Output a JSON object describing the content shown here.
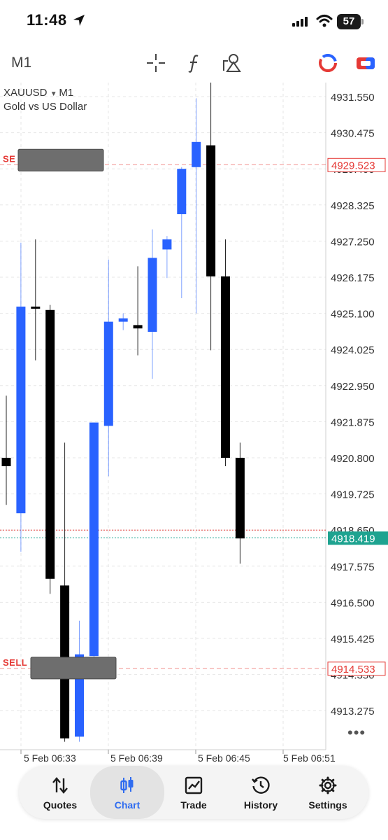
{
  "status": {
    "time": "11:48",
    "battery": "57"
  },
  "toolbar": {
    "timeframe": "M1"
  },
  "chart_data": {
    "type": "candlestick",
    "symbol": "XAUUSD",
    "period": "M1",
    "description": "Gold vs US Dollar",
    "y_ticks": [
      "4931.550",
      "4930.475",
      "4929.400",
      "4928.325",
      "4927.250",
      "4926.175",
      "4925.100",
      "4924.025",
      "4922.950",
      "4921.875",
      "4920.800",
      "4919.725",
      "4918.650",
      "4917.575",
      "4916.500",
      "4915.425",
      "4914.350",
      "4913.275"
    ],
    "y_range": [
      4912.35,
      4932.4
    ],
    "x_labels": [
      "5 Feb 06:33",
      "5 Feb 06:39",
      "5 Feb 06:45",
      "5 Feb 06:51"
    ],
    "candles": [
      {
        "o": 4920.8,
        "h": 4922.65,
        "l": 4919.4,
        "c": 4920.55
      },
      {
        "o": 4919.15,
        "h": 4927.2,
        "l": 4918.0,
        "c": 4925.3
      },
      {
        "o": 4925.3,
        "h": 4927.3,
        "l": 4923.7,
        "c": 4925.25
      },
      {
        "o": 4925.2,
        "h": 4925.35,
        "l": 4916.75,
        "c": 4917.2
      },
      {
        "o": 4917.0,
        "h": 4921.25,
        "l": 4912.35,
        "c": 4912.45
      },
      {
        "o": 4912.5,
        "h": 4915.95,
        "l": 4912.35,
        "c": 4914.95
      },
      {
        "o": 4914.9,
        "h": 4921.85,
        "l": 4914.6,
        "c": 4921.85
      },
      {
        "o": 4921.75,
        "h": 4926.7,
        "l": 4920.25,
        "c": 4924.85
      },
      {
        "o": 4924.85,
        "h": 4925.1,
        "l": 4924.6,
        "c": 4924.95
      },
      {
        "o": 4924.75,
        "h": 4926.5,
        "l": 4923.85,
        "c": 4924.65
      },
      {
        "o": 4924.55,
        "h": 4927.6,
        "l": 4923.15,
        "c": 4926.75
      },
      {
        "o": 4927.0,
        "h": 4927.4,
        "l": 4926.15,
        "c": 4927.3
      },
      {
        "o": 4928.05,
        "h": 4929.45,
        "l": 4925.55,
        "c": 4929.4
      },
      {
        "o": 4929.45,
        "h": 4931.5,
        "l": 4925.1,
        "c": 4930.2
      },
      {
        "o": 4930.1,
        "h": 4932.4,
        "l": 4924.0,
        "c": 4926.2
      },
      {
        "o": 4926.2,
        "h": 4927.3,
        "l": 4920.55,
        "c": 4920.8
      },
      {
        "o": 4920.8,
        "h": 4921.25,
        "l": 4917.65,
        "c": 4918.4
      }
    ],
    "price_lines": [
      {
        "price": 4929.523,
        "label": "4929.523",
        "color": "#e53935",
        "style": "dashed-light"
      },
      {
        "price": 4914.533,
        "label": "4914.533",
        "color": "#e53935",
        "style": "dashed-light"
      },
      {
        "price": 4918.65,
        "label": "",
        "color": "#e53935",
        "style": "dotted"
      },
      {
        "price": 4918.419,
        "label": "4918.419",
        "color": "#1ea390",
        "style": "dotted"
      }
    ],
    "orders": [
      {
        "label": "SELL",
        "price": 4929.523,
        "truncated_label": "SE"
      },
      {
        "label": "SELL",
        "price": 4914.533,
        "truncated_label": "SELL"
      }
    ],
    "colors": {
      "bull": "#2962ff",
      "bear": "#000000",
      "grid": "#e6e6e6",
      "axis_text": "#333333"
    }
  },
  "nav": {
    "items": [
      {
        "label": "Quotes",
        "icon": "arrows-up-down-icon"
      },
      {
        "label": "Chart",
        "icon": "candlestick-icon"
      },
      {
        "label": "Trade",
        "icon": "trend-chart-icon"
      },
      {
        "label": "History",
        "icon": "history-clock-icon"
      },
      {
        "label": "Settings",
        "icon": "gear-icon"
      }
    ],
    "active": "Chart"
  }
}
